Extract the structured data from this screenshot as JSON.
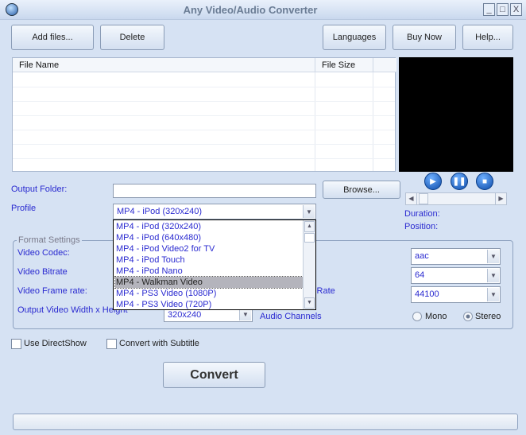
{
  "window": {
    "title": "Any Video/Audio Converter",
    "minimize": "_",
    "maximize": "□",
    "close": "X"
  },
  "toolbar": {
    "add_files": "Add files...",
    "delete": "Delete",
    "languages": "Languages",
    "buy_now": "Buy Now",
    "help": "Help..."
  },
  "file_list": {
    "columns": [
      "File Name",
      "File Size"
    ],
    "rows": []
  },
  "player": {
    "play_icon": "play-icon",
    "pause_icon": "pause-icon",
    "stop_icon": "stop-icon",
    "duration_label": "Duration:",
    "position_label": "Position:"
  },
  "output": {
    "folder_label": "Output Folder:",
    "folder_value": "",
    "browse": "Browse...",
    "profile_label": "Profile",
    "profile_value": "MP4 - iPod (320x240)"
  },
  "profile_options": [
    "MP4 - iPod (320x240)",
    "MP4 - iPod (640x480)",
    "MP4 - iPod Video2 for TV",
    "MP4 - iPod Touch",
    "MP4 - iPod Nano",
    "MP4 - Walkman Video",
    "MP4 - PS3 Video (1080P)",
    "MP4 - PS3 Video (720P)"
  ],
  "profile_highlighted": "MP4 - Walkman Video",
  "format": {
    "legend": "Format Settings",
    "video_codec": "Video Codec:",
    "video_bitrate": "Video Bitrate",
    "video_frame_rate": "Video Frame rate:",
    "output_size": "Output Video Width x Height",
    "output_size_value": "320x240",
    "audio_sample_rate": "Audio Sample Rate",
    "audio_channels": "Audio Channels",
    "audio_codec_value": "aac",
    "audio_bitrate_value": "64",
    "audio_sample_rate_value": "44100",
    "mono": "Mono",
    "stereo": "Stereo",
    "channel_selected": "Stereo"
  },
  "options": {
    "use_directshow": "Use DirectShow",
    "convert_subtitle": "Convert with Subtitle"
  },
  "convert": "Convert",
  "progress": 0
}
